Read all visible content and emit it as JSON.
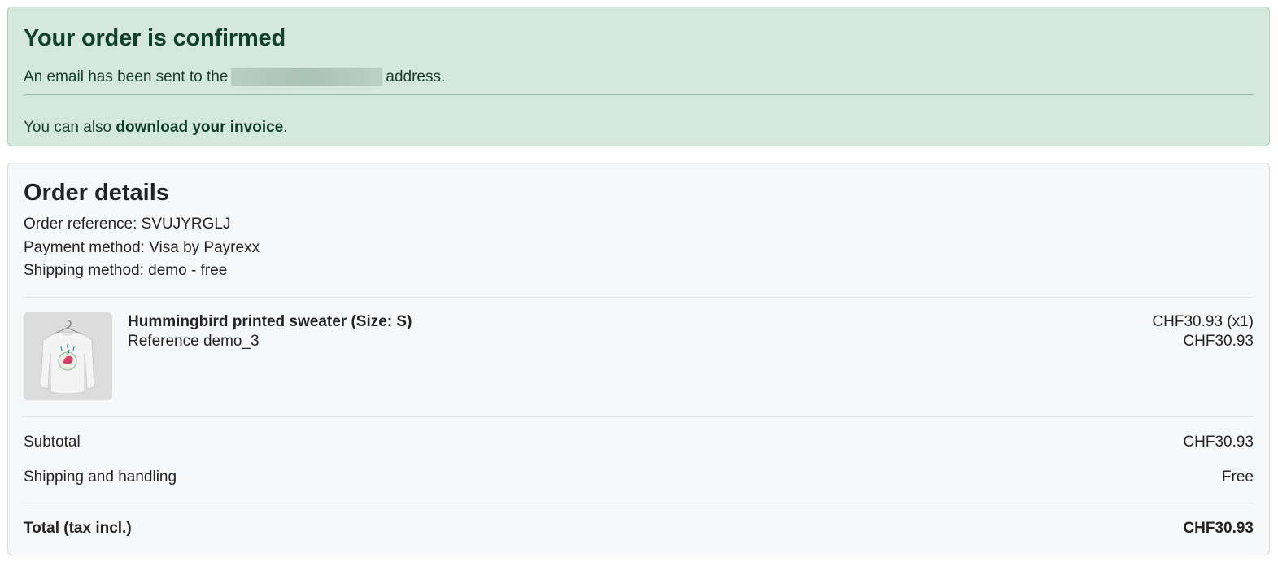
{
  "confirmation": {
    "title": "Your order is confirmed",
    "email_prefix": "An email has been sent to the",
    "email_suffix": "address.",
    "invoice_prefix": "You can also",
    "invoice_link": "download your invoice",
    "invoice_suffix": "."
  },
  "order": {
    "title": "Order details",
    "reference": "Order reference: SVUJYRGLJ",
    "payment": "Payment method: Visa by Payrexx",
    "shipping": "Shipping method: demo - free",
    "product": {
      "name": "Hummingbird printed sweater (Size: S)",
      "reference": "Reference demo_3",
      "unit_price": "CHF30.93 (x1)",
      "line_total": "CHF30.93",
      "image_icon": "sweater-thumbnail"
    },
    "summary": {
      "subtotal_label": "Subtotal",
      "subtotal_value": "CHF30.93",
      "shipping_label": "Shipping and handling",
      "shipping_value": "Free",
      "total_label": "Total (tax incl.)",
      "total_value": "CHF30.93"
    }
  },
  "colors": {
    "success_bg": "#d4e8de",
    "success_border": "#a9d3bd",
    "success_text": "#0f3c27",
    "card_bg": "#f7f8fa"
  }
}
